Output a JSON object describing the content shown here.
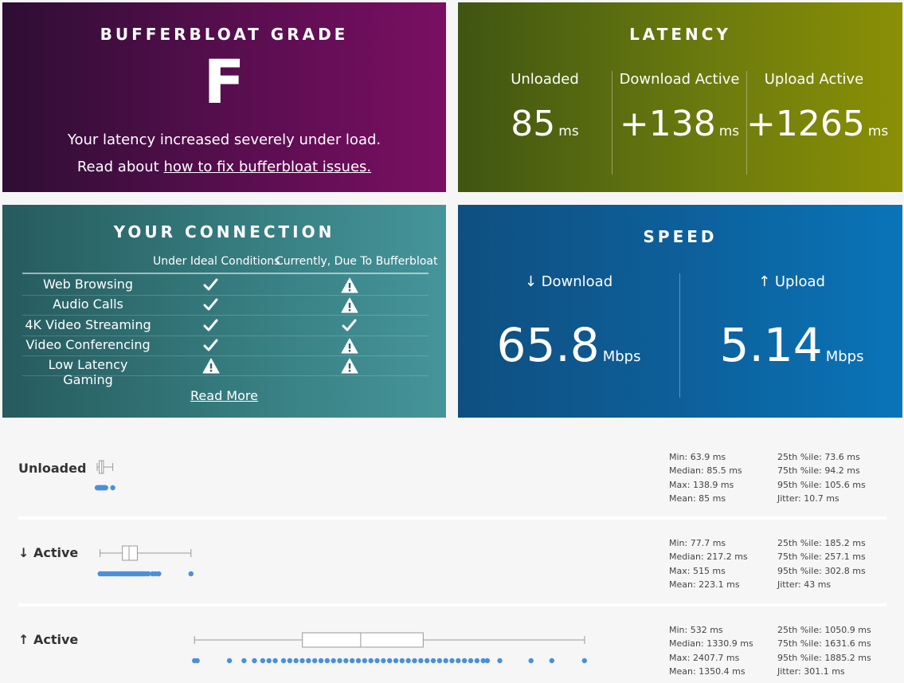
{
  "grade": {
    "title": "BUFFERBLOAT GRADE",
    "letter": "F",
    "line1": "Your latency increased severely under load.",
    "line2_prefix": "Read about ",
    "line2_link": "how to fix bufferbloat issues."
  },
  "latency": {
    "title": "LATENCY",
    "columns": [
      {
        "label": "Unloaded",
        "value": "85",
        "unit": "ms"
      },
      {
        "label": "Download Active",
        "value": "+138",
        "unit": "ms"
      },
      {
        "label": "Upload Active",
        "value": "+1265",
        "unit": "ms"
      }
    ]
  },
  "connection": {
    "title": "YOUR CONNECTION",
    "col_ideal": "Under Ideal Conditions",
    "col_current": "Currently, Due To Bufferbloat",
    "rows": [
      {
        "name": "Web Browsing",
        "ideal": "check-icon",
        "current": "warning-icon"
      },
      {
        "name": "Audio Calls",
        "ideal": "check-icon",
        "current": "warning-icon"
      },
      {
        "name": "4K Video Streaming",
        "ideal": "check-icon",
        "current": "check-icon"
      },
      {
        "name": "Video Conferencing",
        "ideal": "check-icon",
        "current": "warning-icon"
      },
      {
        "name": "Low Latency Gaming",
        "ideal": "warning-icon",
        "current": "warning-icon"
      }
    ],
    "read_more": "Read More"
  },
  "speed": {
    "title": "SPEED",
    "download": {
      "label": "↓ Download",
      "value": "65.8",
      "unit": "Mbps"
    },
    "upload": {
      "label": "↑ Upload",
      "value": "5.14",
      "unit": "Mbps"
    }
  },
  "latency_details": [
    {
      "label": "Unloaded",
      "stats_left": [
        "Min: 63.9 ms",
        "Median: 85.5 ms",
        "Max: 138.9 ms",
        "Mean: 85 ms"
      ],
      "stats_right": [
        "25th %ile: 73.6 ms",
        "75th %ile: 94.2 ms",
        "95th %ile: 105.6 ms",
        "Jitter: 10.7 ms"
      ],
      "box": {
        "min": 63.9,
        "q1": 73.6,
        "median": 85.5,
        "q3": 94.2,
        "max": 138.9
      },
      "points": [
        64,
        66,
        68,
        70,
        72,
        74,
        76,
        78,
        80,
        82,
        84,
        86,
        88,
        90,
        92,
        94,
        96,
        98,
        100,
        103,
        105,
        139
      ]
    },
    {
      "label": "↓ Active",
      "stats_left": [
        "Min: 77.7 ms",
        "Median: 217.2 ms",
        "Max: 515 ms",
        "Mean: 223.1 ms"
      ],
      "stats_right": [
        "25th %ile: 185.2 ms",
        "75th %ile: 257.1 ms",
        "95th %ile: 302.8 ms",
        "Jitter: 43 ms"
      ],
      "box": {
        "min": 77.7,
        "q1": 185.2,
        "median": 217.2,
        "q3": 257.1,
        "max": 515
      },
      "points": [
        78,
        85,
        95,
        105,
        115,
        125,
        135,
        145,
        155,
        165,
        172,
        180,
        186,
        192,
        198,
        204,
        210,
        216,
        222,
        228,
        234,
        240,
        246,
        252,
        258,
        264,
        270,
        276,
        282,
        290,
        300,
        310,
        330,
        345,
        360,
        515
      ]
    },
    {
      "label": "↑ Active",
      "stats_left": [
        "Min: 532 ms",
        "Median: 1330.9 ms",
        "Max: 2407.7 ms",
        "Mean: 1350.4 ms"
      ],
      "stats_right": [
        "25th %ile: 1050.9 ms",
        "75th %ile: 1631.6 ms",
        "95th %ile: 1885.2 ms",
        "Jitter: 301.1 ms"
      ],
      "box": {
        "min": 532,
        "q1": 1050.9,
        "median": 1330.9,
        "q3": 1631.6,
        "max": 2407.7
      },
      "points": [
        532,
        545,
        700,
        770,
        820,
        860,
        890,
        920,
        960,
        990,
        1020,
        1050,
        1080,
        1110,
        1140,
        1170,
        1200,
        1230,
        1260,
        1290,
        1320,
        1350,
        1380,
        1410,
        1440,
        1470,
        1500,
        1530,
        1560,
        1590,
        1620,
        1650,
        1680,
        1710,
        1740,
        1770,
        1800,
        1830,
        1860,
        1890,
        1920,
        1940,
        2000,
        2150,
        2250,
        2407
      ]
    }
  ]
}
